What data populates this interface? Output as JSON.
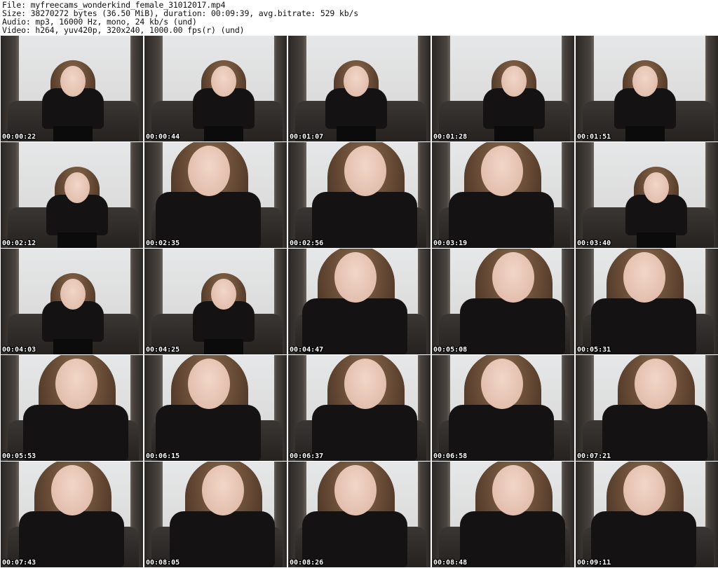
{
  "header": {
    "file_line": "File: myfreecams_wonderkind_female_31012017.mp4",
    "size_line": "Size: 38270272 bytes (36.50 MiB), duration: 00:09:39, avg.bitrate: 529 kb/s",
    "audio_line": "Audio: mp3, 16000 Hz, mono, 24 kb/s (und)",
    "video_line": "Video: h264, yuv420p, 320x240, 1000.00 fps(r) (und)"
  },
  "thumbnails": [
    {
      "timestamp": "00:00:22",
      "framing": "wide"
    },
    {
      "timestamp": "00:00:44",
      "framing": "wide"
    },
    {
      "timestamp": "00:01:07",
      "framing": "wide"
    },
    {
      "timestamp": "00:01:28",
      "framing": "wide"
    },
    {
      "timestamp": "00:01:51",
      "framing": "wide"
    },
    {
      "timestamp": "00:02:12",
      "framing": "wide"
    },
    {
      "timestamp": "00:02:35",
      "framing": "close"
    },
    {
      "timestamp": "00:02:56",
      "framing": "close"
    },
    {
      "timestamp": "00:03:19",
      "framing": "close"
    },
    {
      "timestamp": "00:03:40",
      "framing": "wide"
    },
    {
      "timestamp": "00:04:03",
      "framing": "wide"
    },
    {
      "timestamp": "00:04:25",
      "framing": "wide"
    },
    {
      "timestamp": "00:04:47",
      "framing": "close"
    },
    {
      "timestamp": "00:05:08",
      "framing": "close"
    },
    {
      "timestamp": "00:05:31",
      "framing": "close"
    },
    {
      "timestamp": "00:05:53",
      "framing": "close"
    },
    {
      "timestamp": "00:06:15",
      "framing": "close"
    },
    {
      "timestamp": "00:06:37",
      "framing": "close"
    },
    {
      "timestamp": "00:06:58",
      "framing": "close"
    },
    {
      "timestamp": "00:07:21",
      "framing": "close"
    },
    {
      "timestamp": "00:07:43",
      "framing": "close"
    },
    {
      "timestamp": "00:08:05",
      "framing": "close"
    },
    {
      "timestamp": "00:08:26",
      "framing": "close"
    },
    {
      "timestamp": "00:08:48",
      "framing": "close"
    },
    {
      "timestamp": "00:09:11",
      "framing": "close"
    }
  ]
}
